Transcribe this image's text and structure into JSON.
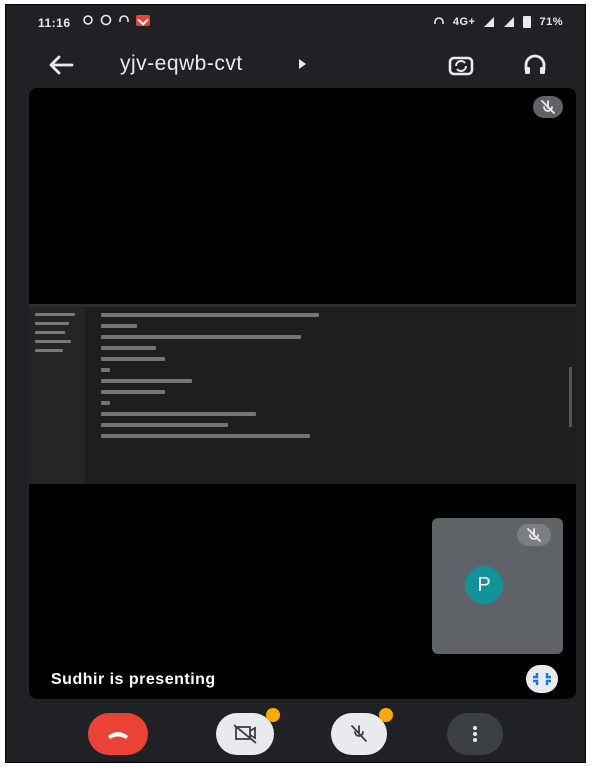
{
  "status_bar": {
    "time": "11:16",
    "network": "4G+",
    "battery": "71%"
  },
  "header": {
    "meeting_code": "yjv-eqwb-cvt"
  },
  "stage": {
    "presenting_text": "Sudhir is presenting",
    "self_avatar_letter": "P"
  },
  "icons": {
    "back": "arrow-left-icon",
    "switch_camera": "switch-camera-icon",
    "audio": "headphones-icon",
    "mic_off": "mic-off-icon",
    "cam_off": "camera-off-icon",
    "end_call": "end-call-icon",
    "more": "more-vertical-icon",
    "fit": "fit-screen-icon"
  },
  "colors": {
    "end_call": "#ea4335",
    "avatar": "#12939a",
    "badge": "#f9ab00"
  }
}
